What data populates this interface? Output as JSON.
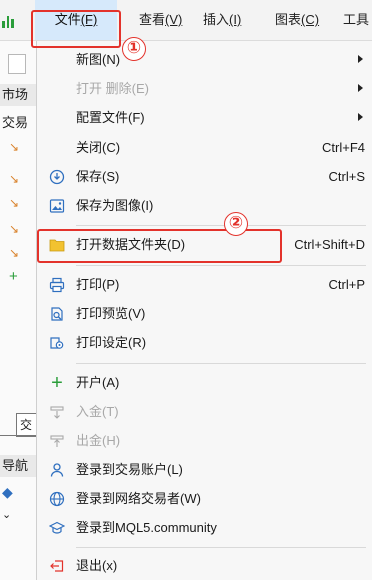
{
  "menubar": {
    "file": {
      "label": "文件",
      "key": "(F)"
    },
    "view": {
      "label": "查看",
      "key": "(V)"
    },
    "insert": {
      "label": "插入",
      "key": "(I)"
    },
    "charts": {
      "label": "图表",
      "key": "(C)"
    },
    "tools": {
      "label": "工具"
    }
  },
  "markers": {
    "first": "①",
    "second": "②"
  },
  "background": {
    "market_watch": "市场",
    "trade": "交易",
    "terminal_tab": "交易",
    "navigator": "导航"
  },
  "file_menu": {
    "items": [
      {
        "label": "新图(N)",
        "submenu": true
      },
      {
        "label": "打开 删除(E)",
        "submenu": true,
        "disabled": true
      },
      {
        "label": "配置文件(F)",
        "submenu": true
      },
      {
        "label": "关闭(C)",
        "shortcut": "Ctrl+F4"
      },
      {
        "label": "保存(S)",
        "shortcut": "Ctrl+S",
        "icon": "save-icon"
      },
      {
        "label": "保存为图像(I)",
        "icon": "save-as-image-icon"
      },
      {
        "label": "打开数据文件夹(D)",
        "shortcut": "Ctrl+Shift+D",
        "icon": "folder-icon"
      },
      {
        "label": "打印(P)",
        "shortcut": "Ctrl+P",
        "icon": "printer-icon"
      },
      {
        "label": "打印预览(V)",
        "icon": "print-preview-icon"
      },
      {
        "label": "打印设定(R)",
        "icon": "print-setup-icon"
      },
      {
        "label": "开户(A)",
        "icon": "plus-icon"
      },
      {
        "label": "入金(T)",
        "icon": "deposit-icon",
        "disabled": true
      },
      {
        "label": "出金(H)",
        "icon": "withdraw-icon",
        "disabled": true
      },
      {
        "label": "登录到交易账户(L)",
        "icon": "user-icon"
      },
      {
        "label": "登录到网络交易者(W)",
        "icon": "globe-icon"
      },
      {
        "label": "登录到MQL5.community",
        "icon": "graduation-cap-icon"
      },
      {
        "label": "退出(x)",
        "icon": "exit-icon"
      }
    ]
  },
  "colors": {
    "highlight_red": "#e3322b",
    "icon_blue": "#2f6fbf",
    "folder_yellow": "#f2c230",
    "menu_active": "#d6e9fb"
  }
}
